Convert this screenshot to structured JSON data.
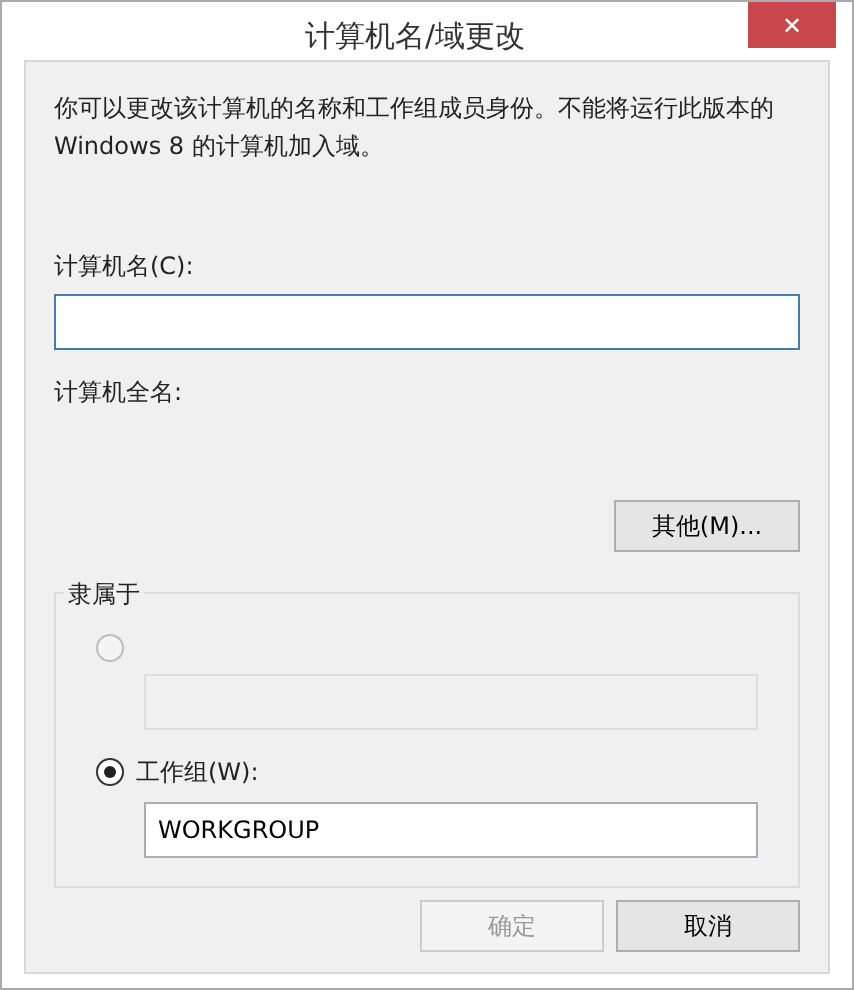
{
  "window": {
    "title": "计算机名/域更改",
    "close": "✕"
  },
  "description": "你可以更改该计算机的名称和工作组成员身份。不能将运行此版本的 Windows 8 的计算机加入域。",
  "computer_name": {
    "label": "计算机名(C):",
    "focused": true
  },
  "full_name": {
    "label": "计算机全名:"
  },
  "more_button": "其他(M)...",
  "member_of": {
    "legend": "隶属于",
    "options": [
      {
        "selected": false,
        "disabled": true
      },
      {
        "label": "工作组(W):",
        "selected": true,
        "disabled": false,
        "value": "WORKGROUP"
      }
    ]
  },
  "buttons": [
    {
      "label": "确定",
      "disabled": true
    },
    {
      "label": "取消",
      "disabled": false
    }
  ]
}
